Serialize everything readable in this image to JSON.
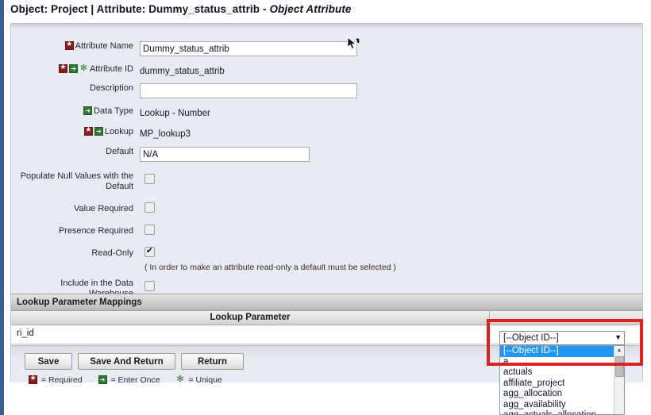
{
  "header": {
    "title_plain": "Object: Project | Attribute: Dummy_status_attrib - ",
    "title_italic": "Object Attribute"
  },
  "form": {
    "rows": [
      {
        "label": "Attribute Name",
        "badges": [
          "required"
        ],
        "type": "textinput",
        "value": "Dummy_status_attrib"
      },
      {
        "label": "Attribute ID",
        "badges": [
          "required",
          "enteronce",
          "unique"
        ],
        "type": "static",
        "value": "dummy_status_attrib"
      },
      {
        "label": "Description",
        "badges": [],
        "type": "textinput",
        "value": ""
      },
      {
        "label": "Data Type",
        "badges": [
          "enteronce"
        ],
        "type": "static",
        "value": "Lookup - Number"
      },
      {
        "label": "Lookup",
        "badges": [
          "required",
          "enteronce"
        ],
        "type": "static",
        "value": "MP_lookup3"
      },
      {
        "label": "Default",
        "badges": [],
        "type": "textinput",
        "value": "N/A"
      },
      {
        "label": "Populate Null Values with the Default",
        "badges": [],
        "type": "checkbox",
        "checked": false
      },
      {
        "label": "Value Required",
        "badges": [],
        "type": "checkbox",
        "checked": false
      },
      {
        "label": "Presence Required",
        "badges": [],
        "type": "checkbox",
        "checked": false
      },
      {
        "label": "Read-Only",
        "badges": [],
        "type": "checkbox",
        "checked": true,
        "note": "( In order to make an attribute read-only a default must be selected )"
      },
      {
        "label": "Include in the Data Warehouse",
        "badges": [],
        "type": "checkbox",
        "checked": false
      }
    ]
  },
  "section": {
    "title": "Lookup Parameter Mappings"
  },
  "table": {
    "column_header": "Lookup Parameter",
    "row_param": "ri_id"
  },
  "dropdown": {
    "selected": "[--Object ID--]",
    "arrow_glyph": "▼",
    "options": [
      "[--Object ID--]",
      "a",
      "actuals",
      "affiliate_project",
      "agg_allocation",
      "agg_availability",
      "agg_actuals_allocation"
    ],
    "scroll_up_glyph": "▲"
  },
  "buttons": {
    "save": "Save",
    "save_and_return": "Save And Return",
    "return": "Return"
  },
  "legend": {
    "required": "= Required",
    "enter_once": "= Enter Once",
    "unique": "= Unique"
  },
  "colors": {
    "rail_blue": "#3a6098",
    "panel_bg": "#e9ebf3",
    "required_badge": "#8e1c1c",
    "enteronce_badge": "#2f7a33",
    "highlight_red": "#e02020",
    "select_blue": "#2196f3"
  }
}
